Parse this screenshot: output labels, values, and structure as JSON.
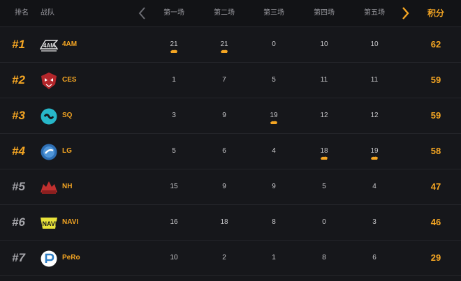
{
  "header": {
    "rank": "排名",
    "team": "战队",
    "matches": [
      "第一场",
      "第二场",
      "第三场",
      "第四场",
      "第五场"
    ],
    "total": "积分"
  },
  "colors": {
    "accent": "#f5a623",
    "background": "#16171b",
    "header": "#121316"
  },
  "icons": {
    "prev": "chevron-left-icon",
    "next": "chevron-right-icon",
    "chicken": "chicken-dinner-icon"
  },
  "rows": [
    {
      "rank": "#1",
      "team": "4AM",
      "logo": "logo-4am",
      "scores": [
        "21",
        "21",
        "0",
        "10",
        "10"
      ],
      "wins": [
        true,
        true,
        false,
        false,
        false
      ],
      "total": "62"
    },
    {
      "rank": "#2",
      "team": "CES",
      "logo": "logo-ces",
      "scores": [
        "1",
        "7",
        "5",
        "11",
        "11"
      ],
      "wins": [
        false,
        false,
        false,
        false,
        false
      ],
      "total": "59"
    },
    {
      "rank": "#3",
      "team": "SQ",
      "logo": "logo-sq",
      "scores": [
        "3",
        "9",
        "19",
        "12",
        "12"
      ],
      "wins": [
        false,
        false,
        true,
        false,
        false
      ],
      "total": "59"
    },
    {
      "rank": "#4",
      "team": "LG",
      "logo": "logo-lg",
      "scores": [
        "5",
        "6",
        "4",
        "18",
        "19"
      ],
      "wins": [
        false,
        false,
        false,
        true,
        true
      ],
      "total": "58"
    },
    {
      "rank": "#5",
      "team": "NH",
      "logo": "logo-nh",
      "scores": [
        "15",
        "9",
        "9",
        "5",
        "4"
      ],
      "wins": [
        false,
        false,
        false,
        false,
        false
      ],
      "total": "47"
    },
    {
      "rank": "#6",
      "team": "NAVI",
      "logo": "logo-navi",
      "scores": [
        "16",
        "18",
        "8",
        "0",
        "3"
      ],
      "wins": [
        false,
        false,
        false,
        false,
        false
      ],
      "total": "46"
    },
    {
      "rank": "#7",
      "team": "PeRo",
      "logo": "logo-pero",
      "scores": [
        "10",
        "2",
        "1",
        "8",
        "6"
      ],
      "wins": [
        false,
        false,
        false,
        false,
        false
      ],
      "total": "29"
    }
  ]
}
